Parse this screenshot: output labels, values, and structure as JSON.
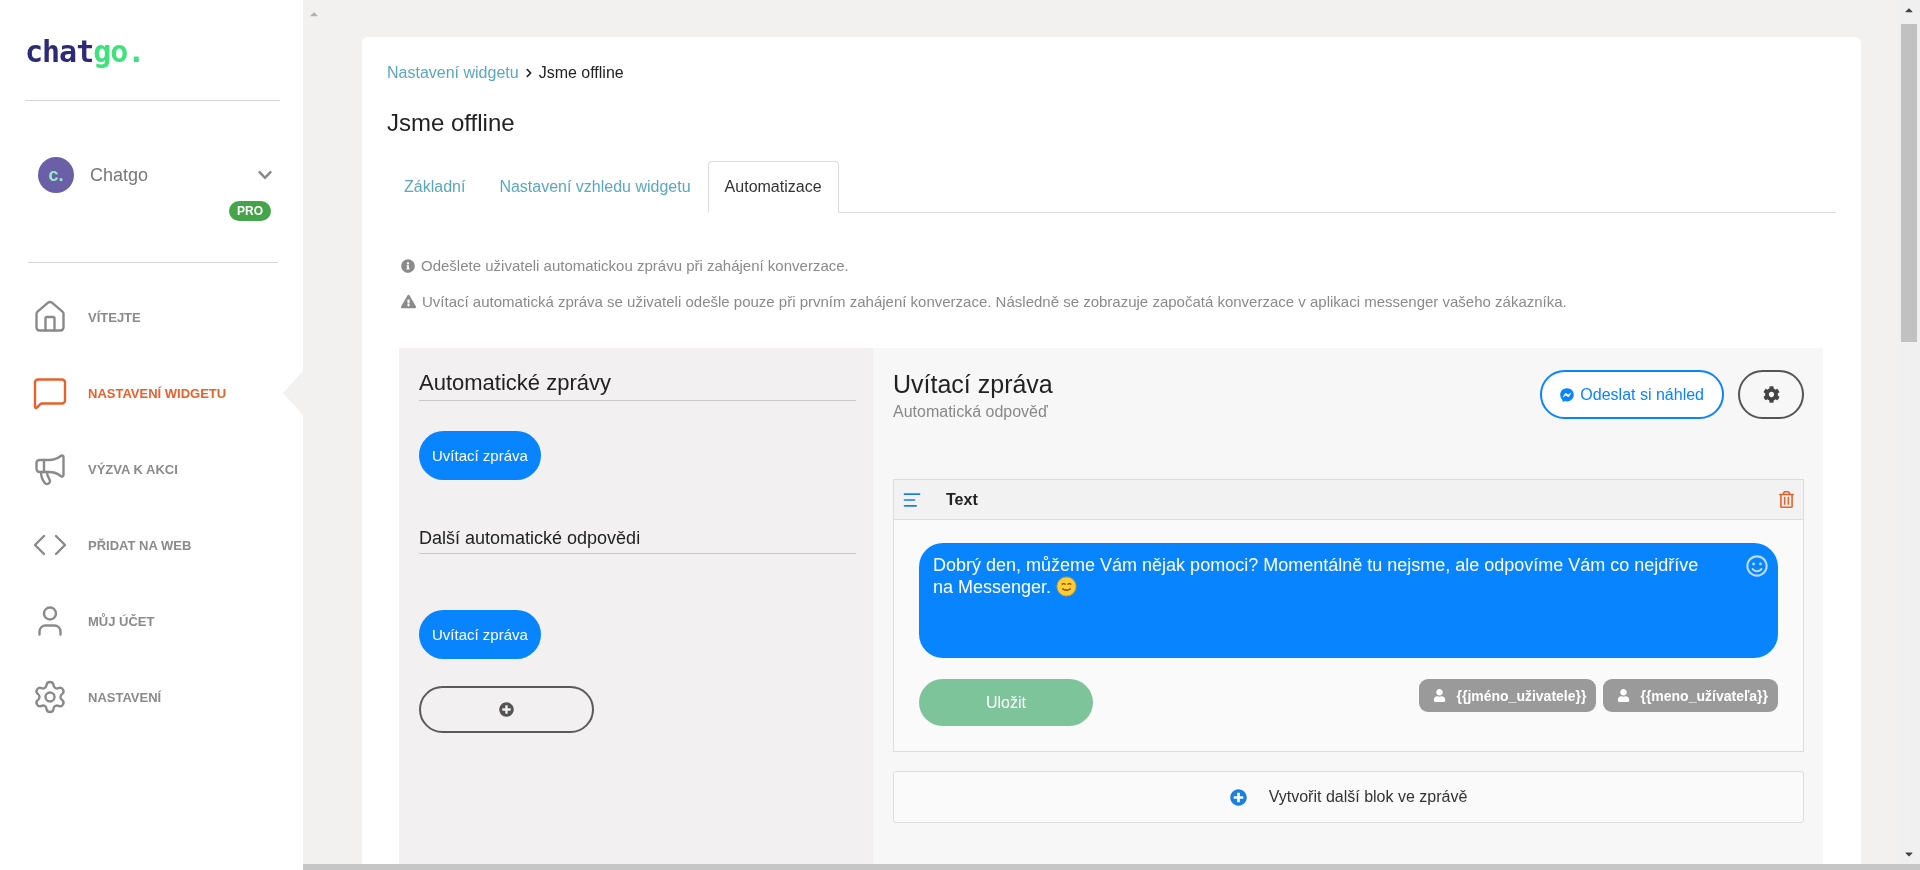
{
  "logo": {
    "parts": [
      {
        "text": "chat",
        "color": "#2d2a78"
      },
      {
        "text": "go.",
        "color": "#3ee27c"
      }
    ]
  },
  "account": {
    "avatar": "c.",
    "name": "Chatgo",
    "badge": "PRO"
  },
  "nav": [
    {
      "kind": "home",
      "label": "VÍTEJTE",
      "selected": false
    },
    {
      "kind": "chat",
      "label": "NASTAVENÍ WIDGETU",
      "selected": true
    },
    {
      "kind": "megaphone",
      "label": "VÝZVA K AKCI",
      "selected": false
    },
    {
      "kind": "code",
      "label": "PŘIDAT NA WEB",
      "selected": false
    },
    {
      "kind": "user",
      "label": "MŮJ ÚČET",
      "selected": false
    },
    {
      "kind": "settings",
      "label": "NASTAVENÍ",
      "selected": false
    }
  ],
  "breadcrumb": {
    "parent": "Nastavení widgetu",
    "current": "Jsme offline"
  },
  "title": "Jsme offline",
  "tabs": [
    {
      "label": "Základní",
      "selected": false
    },
    {
      "label": "Nastavení vzhledu widgetu",
      "selected": false
    },
    {
      "label": "Automatizace",
      "selected": true
    }
  ],
  "notices": [
    {
      "kind": "info",
      "text": "Odešlete uživateli automatickou zprávu při zahájení konverzace."
    },
    {
      "kind": "warning",
      "text": "Uvítací automatická zpráva se uživateli odešle pouze při prvním zahájení konverzace. Následně se zobrazuje započatá konverzace v aplikaci messenger vašeho zákazníka."
    }
  ],
  "automation": {
    "heading": "Automatické zprávy",
    "messages": [
      "Uvítací zpráva"
    ],
    "other_heading": "Další automatické odpovědi",
    "other_messages": [
      "Uvítací zpráva"
    ]
  },
  "editor": {
    "title": "Uvítací zpráva",
    "subtitle": "Automatická odpověď",
    "preview_button": "Odeslat si náhled",
    "block": {
      "label": "Text",
      "message": "Dobrý den, můžeme Vám nějak pomoci? Momentálně tu nejsme, ale odpovíme Vám co nejdříve na Messenger.",
      "save_button": "Uložit",
      "variables": [
        "{{jméno_uživatele}}",
        "{{meno_užívateľa}}"
      ]
    },
    "add_block": "Vytvořit další blok ve zprávě"
  }
}
